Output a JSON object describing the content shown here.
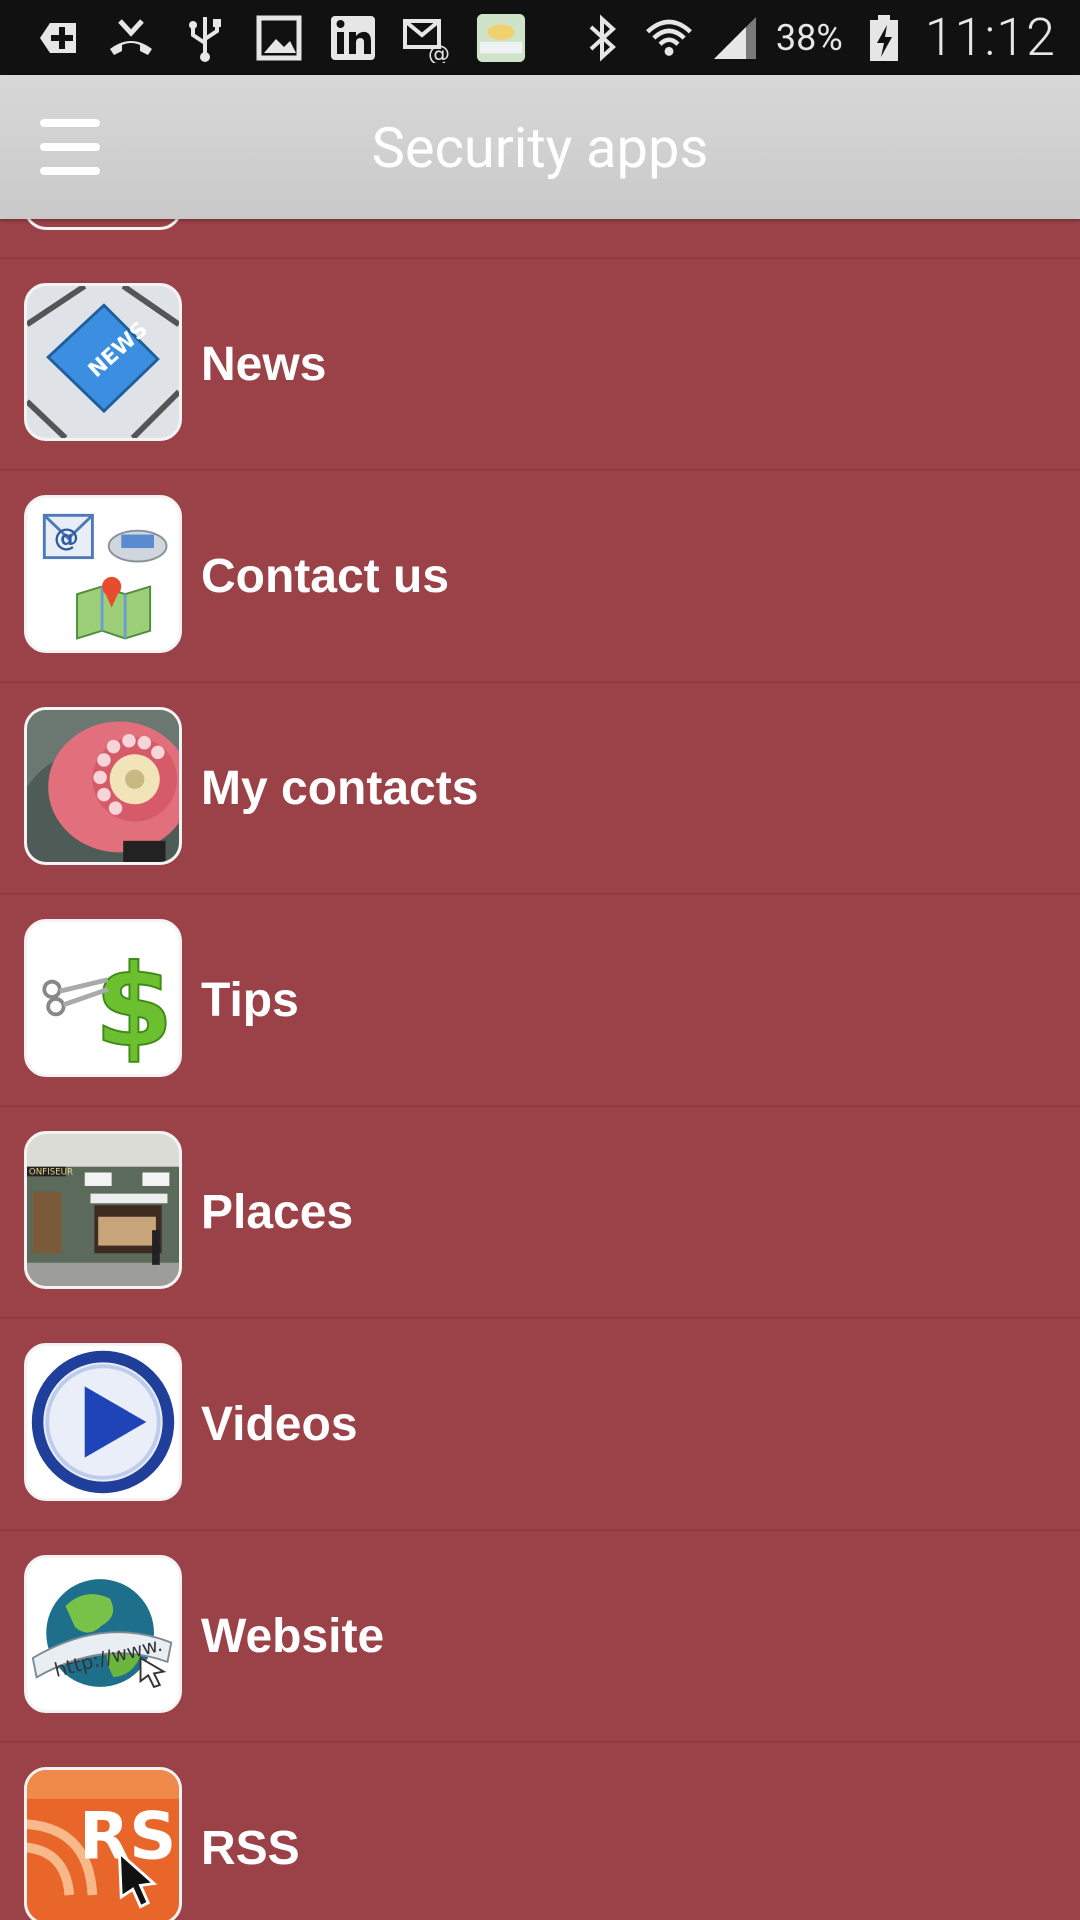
{
  "status_bar": {
    "battery": "38%",
    "time": "11:12",
    "icons": [
      "add-icon",
      "missed-call-icon",
      "usb-icon",
      "image-icon",
      "linkedin-icon",
      "email-sync-icon",
      "app-thumbnail-icon",
      "bluetooth-icon",
      "wifi-icon",
      "signal-icon",
      "battery-charging-icon"
    ]
  },
  "app_bar": {
    "title": "Security apps",
    "menu_icon": "hamburger-menu-icon"
  },
  "list": {
    "items": [
      {
        "label": "",
        "icon": "partial-icon"
      },
      {
        "label": "News",
        "icon": "news-key-icon"
      },
      {
        "label": "Contact us",
        "icon": "contact-icons"
      },
      {
        "label": "My contacts",
        "icon": "rotary-phone-icon"
      },
      {
        "label": "Tips",
        "icon": "dollar-scissors-icon"
      },
      {
        "label": "Places",
        "icon": "storefront-icon"
      },
      {
        "label": "Videos",
        "icon": "play-button-icon"
      },
      {
        "label": "Website",
        "icon": "globe-www-icon"
      },
      {
        "label": "RSS",
        "icon": "rss-icon"
      }
    ]
  },
  "colors": {
    "background": "#9b4248",
    "app_bar": "#cfcfcf",
    "status_bar": "#111111"
  }
}
